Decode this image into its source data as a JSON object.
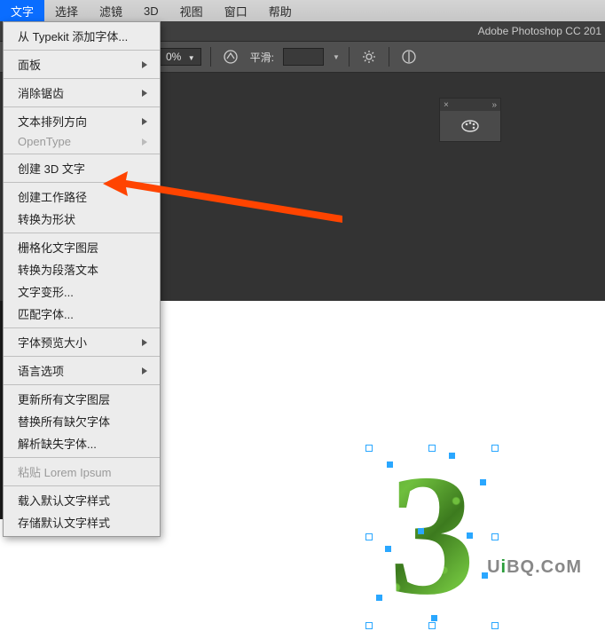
{
  "menubar": {
    "items": [
      "文字",
      "选择",
      "滤镜",
      "3D",
      "视图",
      "窗口",
      "帮助"
    ],
    "active_index": 0
  },
  "titlebar": {
    "app_title": "Adobe Photoshop CC 201"
  },
  "toolbar": {
    "zoom_pct": "0%",
    "smooth_label": "平滑:",
    "smooth_value": "",
    "dropdown_arrow": "▼"
  },
  "dropdown": {
    "items": [
      {
        "label": "从 Typekit 添加字体...",
        "disabled": false,
        "submenu": false
      },
      {
        "sep": true
      },
      {
        "label": "面板",
        "disabled": false,
        "submenu": true
      },
      {
        "sep": true
      },
      {
        "label": "消除锯齿",
        "disabled": false,
        "submenu": true
      },
      {
        "sep": true
      },
      {
        "label": "文本排列方向",
        "disabled": false,
        "submenu": true
      },
      {
        "label": "OpenType",
        "disabled": true,
        "submenu": true
      },
      {
        "sep": true
      },
      {
        "label": "创建 3D 文字",
        "disabled": false,
        "submenu": false
      },
      {
        "sep": true
      },
      {
        "label": "创建工作路径",
        "disabled": false,
        "submenu": false
      },
      {
        "label": "转换为形状",
        "disabled": false,
        "submenu": false
      },
      {
        "sep": true
      },
      {
        "label": "栅格化文字图层",
        "disabled": false,
        "submenu": false
      },
      {
        "label": "转换为段落文本",
        "disabled": false,
        "submenu": false
      },
      {
        "label": "文字变形...",
        "disabled": false,
        "submenu": false
      },
      {
        "label": "匹配字体...",
        "disabled": false,
        "submenu": false
      },
      {
        "sep": true
      },
      {
        "label": "字体预览大小",
        "disabled": false,
        "submenu": true
      },
      {
        "sep": true
      },
      {
        "label": "语言选项",
        "disabled": false,
        "submenu": true
      },
      {
        "sep": true
      },
      {
        "label": "更新所有文字图层",
        "disabled": false,
        "submenu": false
      },
      {
        "label": "替换所有缺欠字体",
        "disabled": false,
        "submenu": false
      },
      {
        "label": "解析缺失字体...",
        "disabled": false,
        "submenu": false
      },
      {
        "sep": true
      },
      {
        "label": "粘贴 Lorem Ipsum",
        "disabled": true,
        "submenu": false
      },
      {
        "sep": true
      },
      {
        "label": "载入默认文字样式",
        "disabled": false,
        "submenu": false
      },
      {
        "label": "存储默认文字样式",
        "disabled": false,
        "submenu": false
      }
    ]
  },
  "float_panel": {
    "close": "×",
    "collapse": "»"
  },
  "canvas": {
    "number_text": "3"
  },
  "watermark": {
    "u": "U",
    "i": "i",
    "rest": "BQ.CoM"
  }
}
